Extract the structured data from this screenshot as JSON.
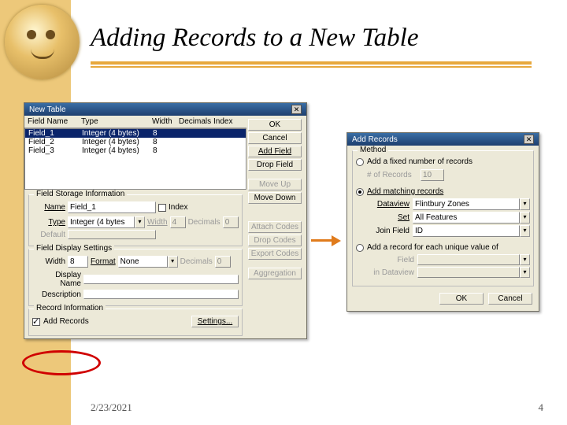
{
  "slide": {
    "title": "Adding Records to a New Table",
    "date": "2/23/2021",
    "page_number": "4"
  },
  "new_table": {
    "title": "New Table",
    "columns": {
      "name": "Field Name",
      "type": "Type",
      "width": "Width",
      "decimals": "Decimals",
      "index": "Index"
    },
    "rows": [
      {
        "name": "Field_1",
        "type": "Integer (4 bytes)",
        "width": "8"
      },
      {
        "name": "Field_2",
        "type": "Integer (4 bytes)",
        "width": "8"
      },
      {
        "name": "Field_3",
        "type": "Integer (4 bytes)",
        "width": "8"
      }
    ],
    "buttons": {
      "ok": "OK",
      "cancel": "Cancel",
      "add_field": "Add Field",
      "drop_field": "Drop Field",
      "move_up": "Move Up",
      "move_down": "Move Down",
      "attach_codes": "Attach Codes",
      "drop_codes": "Drop Codes",
      "export_codes": "Export Codes",
      "aggregation": "Aggregation"
    },
    "storage": {
      "legend": "Field Storage Information",
      "name_label": "Name",
      "name_value": "Field_1",
      "index_label": "Index",
      "type_label": "Type",
      "type_value": "Integer (4 bytes",
      "width_label": "Width",
      "width_value": "4",
      "decimals_label": "Decimals",
      "decimals_value": "0",
      "default_label": "Default",
      "default_value": ""
    },
    "display": {
      "legend": "Field Display Settings",
      "width_label": "Width",
      "width_value": "8",
      "format_label": "Format",
      "format_value": "None",
      "decimals_label": "Decimals",
      "decimals_value": "0",
      "display_name_label": "Display Name",
      "display_name_value": "",
      "description_label": "Description",
      "description_value": ""
    },
    "record_info": {
      "legend": "Record Information",
      "add_records_label": "Add Records",
      "settings_label": "Settings..."
    }
  },
  "add_records": {
    "title": "Add Records",
    "method_legend": "Method",
    "opt_fixed": "Add a fixed number of records",
    "num_records_label": "# of Records",
    "num_records_value": "10",
    "opt_matching": "Add matching records",
    "dataview_label": "Dataview",
    "dataview_value": "Flintbury Zones",
    "set_label": "Set",
    "set_value": "All Features",
    "join_label": "Join Field",
    "join_value": "ID",
    "opt_unique": "Add a record for each unique value of",
    "field_label": "Field",
    "field_value": "",
    "in_dv_label": "in Dataview",
    "in_dv_value": "",
    "ok": "OK",
    "cancel": "Cancel"
  }
}
